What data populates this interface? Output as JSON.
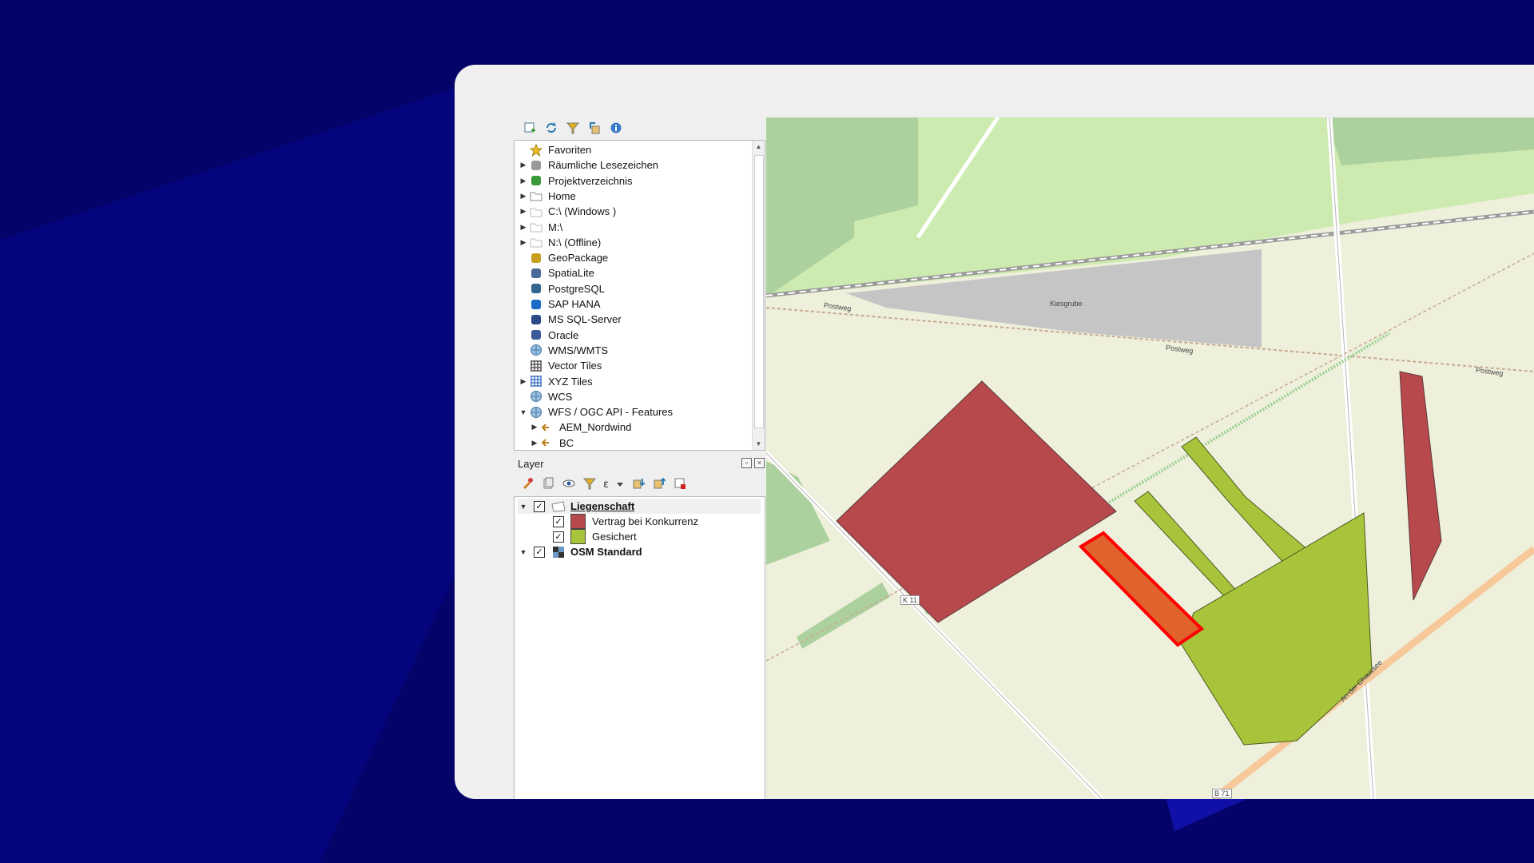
{
  "browser": {
    "tree": [
      {
        "label": "Favoriten",
        "icon": "star-icon",
        "expandable": false
      },
      {
        "label": "Räumliche Lesezeichen",
        "icon": "bookmark-icon",
        "expandable": true
      },
      {
        "label": "Projektverzeichnis",
        "icon": "project-folder-icon",
        "expandable": true
      },
      {
        "label": "Home",
        "icon": "home-folder-icon",
        "expandable": true
      },
      {
        "label": "C:\\ (Windows )",
        "icon": "folder-icon",
        "expandable": true
      },
      {
        "label": "M:\\",
        "icon": "folder-icon",
        "expandable": true
      },
      {
        "label": "N:\\ (Offline)",
        "icon": "folder-icon",
        "expandable": true
      },
      {
        "label": "GeoPackage",
        "icon": "geopackage-icon",
        "expandable": false
      },
      {
        "label": "SpatiaLite",
        "icon": "spatialite-icon",
        "expandable": false
      },
      {
        "label": "PostgreSQL",
        "icon": "postgresql-icon",
        "expandable": false
      },
      {
        "label": "SAP HANA",
        "icon": "sap-hana-icon",
        "expandable": false
      },
      {
        "label": "MS SQL-Server",
        "icon": "mssql-icon",
        "expandable": false
      },
      {
        "label": "Oracle",
        "icon": "oracle-icon",
        "expandable": false
      },
      {
        "label": "WMS/WMTS",
        "icon": "wms-icon",
        "expandable": false
      },
      {
        "label": "Vector Tiles",
        "icon": "vector-tiles-icon",
        "expandable": false
      },
      {
        "label": "XYZ Tiles",
        "icon": "xyz-tiles-icon",
        "expandable": true
      },
      {
        "label": "WCS",
        "icon": "wcs-icon",
        "expandable": false
      },
      {
        "label": "WFS / OGC API - Features",
        "icon": "wfs-icon",
        "expandable": true,
        "expanded": true
      },
      {
        "label": "AEM_Nordwind",
        "icon": "wfs-connection-icon",
        "expandable": true,
        "child": true
      },
      {
        "label": "BC",
        "icon": "wfs-connection-icon",
        "expandable": true,
        "child": true
      }
    ]
  },
  "layers": {
    "title": "Layer",
    "items": [
      {
        "label": "Liegenschaft",
        "checked": true,
        "expanded": true
      },
      {
        "label": "Vertrag bei Konkurrenz",
        "checked": true,
        "color": "#b7484b"
      },
      {
        "label": "Gesichert",
        "checked": true,
        "color": "#a8c43a"
      },
      {
        "label": "OSM Standard",
        "checked": true,
        "expanded": true
      }
    ]
  },
  "map": {
    "labels": {
      "kiesgrube": "Kiesgrube",
      "postweg1": "Postweg",
      "postweg2": "Postweg",
      "postweg3": "Postweg",
      "k11": "K 11",
      "chaussee": "An der Chaussee",
      "b71": "B 71"
    },
    "colors": {
      "contract_competitor": "#b7484b",
      "secured": "#a8c43a",
      "selected_fill": "#e0622c",
      "selected_outline": "#ff0000",
      "forest": "#add19e",
      "meadow": "#cdebb0",
      "quarry": "#c5c5c5",
      "farmland": "#eef0dc"
    }
  }
}
